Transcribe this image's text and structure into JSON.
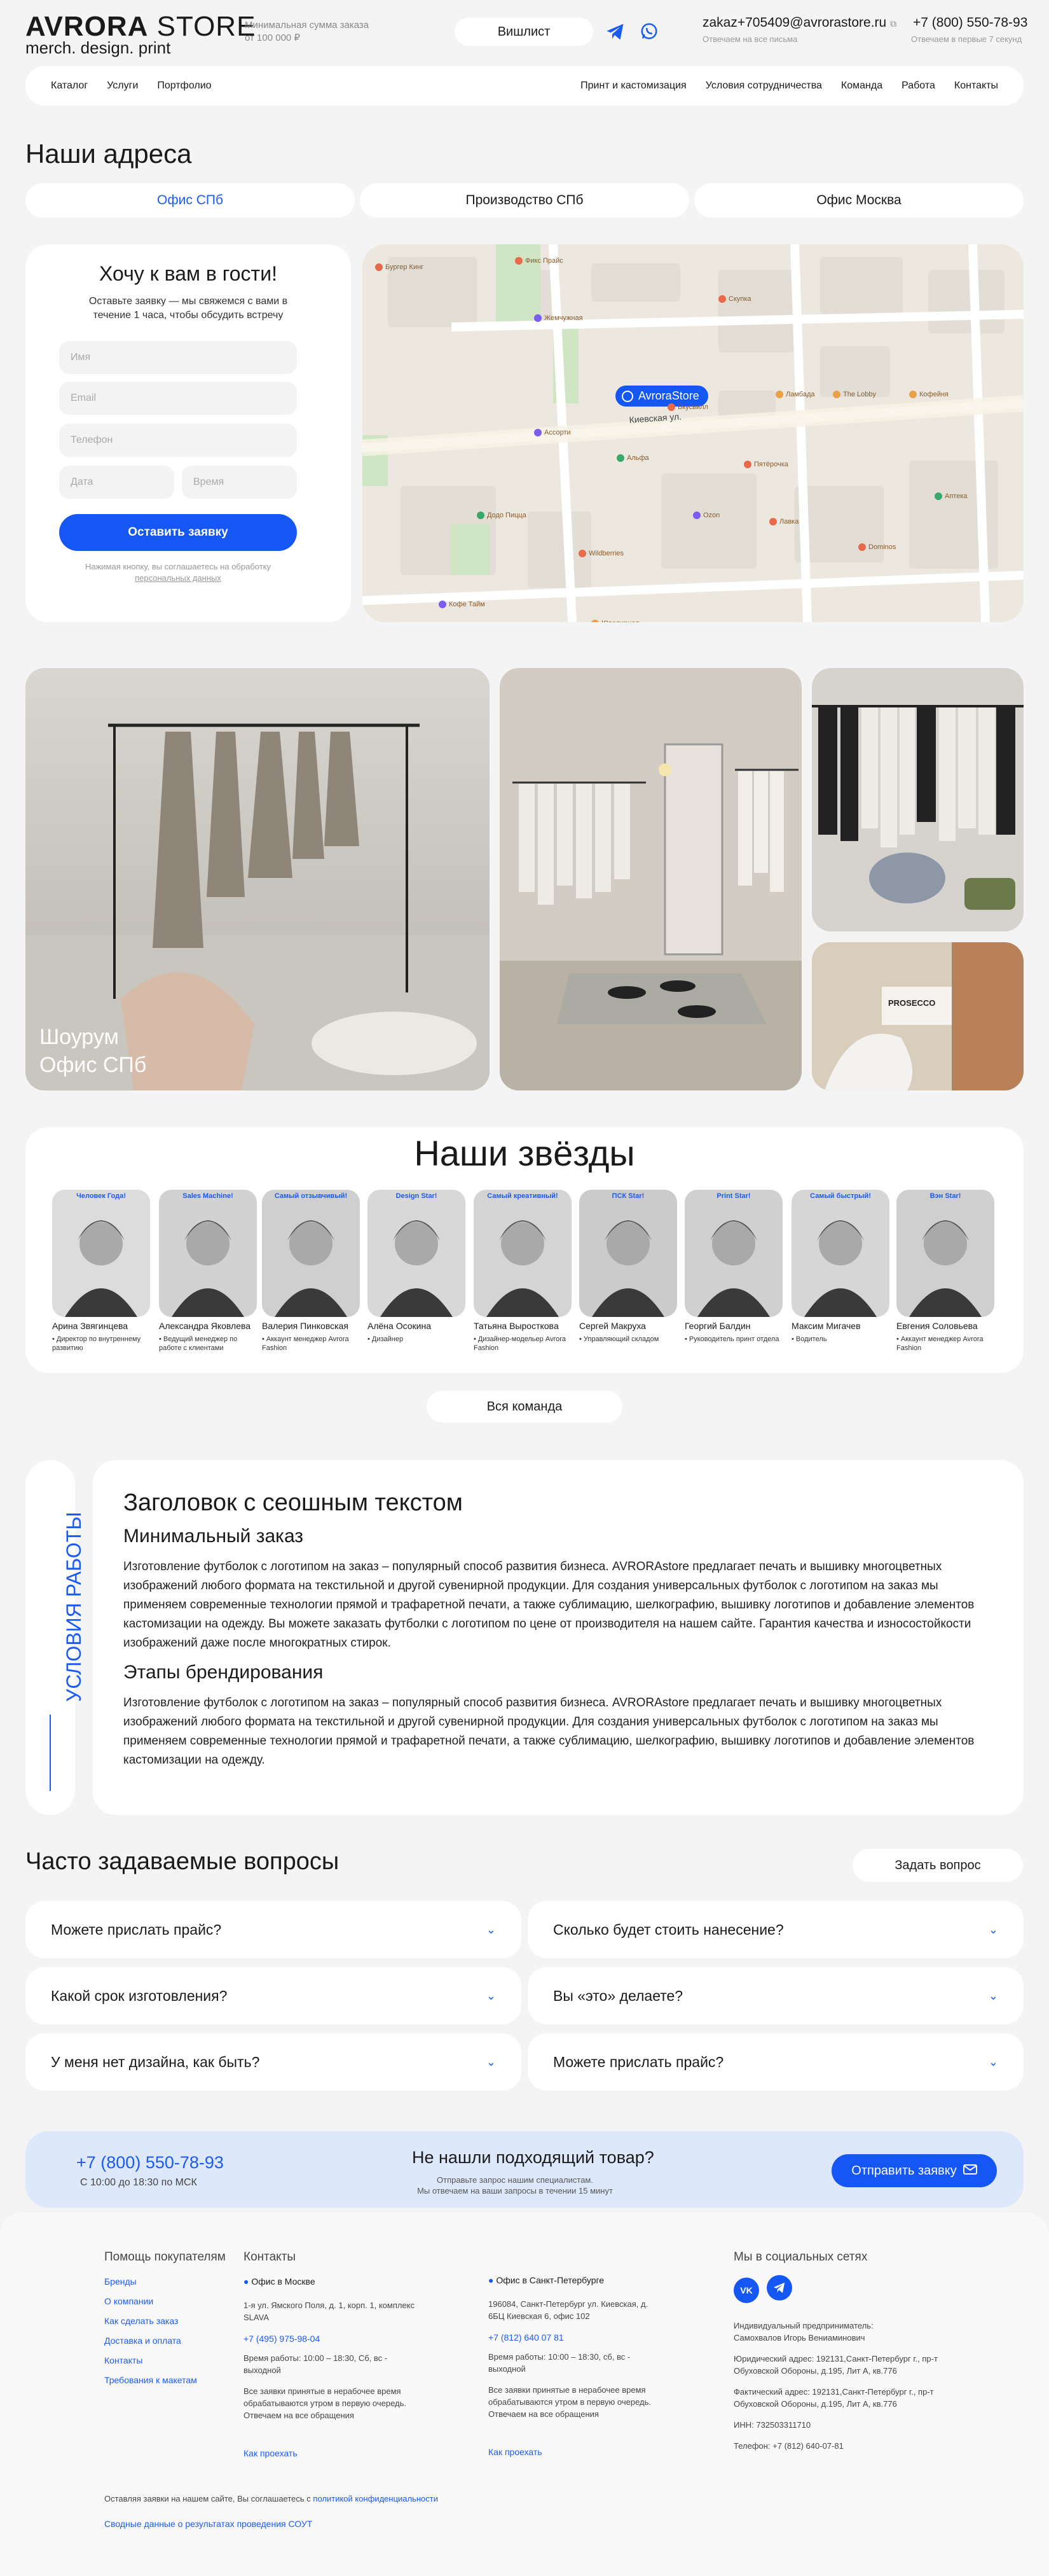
{
  "header": {
    "logo_main": "AVRORA",
    "logo_store": "STORE",
    "logo_tagline": "merch. design. print",
    "min_order_line1": "Минимальная сумма заказа",
    "min_order_line2": "от 100 000 ₽",
    "wishlist": "Вишлист",
    "email": "zakaz+705409@avrorastore.ru",
    "email_note": "Отвечаем на все письма",
    "phone": "+7 (800) 550-78-93",
    "phone_note": "Отвечаем в первые 7 секунд"
  },
  "nav": {
    "left": [
      "Каталог",
      "Услуги",
      "Портфолио"
    ],
    "right": [
      "Принт и кастомизация",
      "Условия сотрудничества",
      "Команда",
      "Работа",
      "Контакты"
    ]
  },
  "addresses": {
    "title": "Наши адреса",
    "tabs": [
      "Офис СПб",
      "Производство СПб",
      "Офис Москва"
    ],
    "active_tab": 0
  },
  "form": {
    "title": "Хочу к вам в гости!",
    "subtitle": "Оставьте заявку — мы свяжемся с вами в течение 1 часа, чтобы обсудить встречу",
    "name_ph": "Имя",
    "email_ph": "Email",
    "phone_ph": "Телефон",
    "date_ph": "Дата",
    "time_ph": "Время",
    "submit": "Оставить заявку",
    "consent_a": "Нажимая кнопку, вы соглашаетесь на обработку",
    "consent_b": "персональных данных"
  },
  "map": {
    "pin": "AvroraStore",
    "street": "Киевская ул.",
    "labels": [
      "Бургер Кинг",
      "Фикс Прайс",
      "Скупка",
      "Жемчужная",
      "Ламбада",
      "The Lobby",
      "Кофейня",
      "Пятёрочка",
      "Ассорти",
      "Альфа",
      "Вкусвилл",
      "Додо Пицца",
      "Wildberries",
      "Ozon",
      "Лавка",
      "Ювелирная",
      "Кофе Тайм",
      "Dominos",
      "Аптека"
    ]
  },
  "gallery": {
    "caption_line1": "Шоурум",
    "caption_line2": "Офис СПб",
    "sign": "PROSECCO"
  },
  "team": {
    "title": "Наши звёзды",
    "members": [
      {
        "badge": "Человек Года!",
        "name": "Арина Звягинцева",
        "role": "• Директор по внутреннему развитию"
      },
      {
        "badge": "Sales Machine!",
        "name": "Александра Яковлева",
        "role": "• Ведущий менеджер по работе с клиентами"
      },
      {
        "badge": "Самый отзывчивый!",
        "name": "Валерия Пинковская",
        "role": "• Аккаунт менеджер Avrora Fashion"
      },
      {
        "badge": "Design Star!",
        "name": "Алёна Осокина",
        "role": "• Дизайнер"
      },
      {
        "badge": "Самый креативный!",
        "name": "Татьяна Выростковa",
        "role": "• Дизайнер-модельер Avrora Fashion"
      },
      {
        "badge": "ПСК Star!",
        "name": "Сергей Макруха",
        "role": "• Управляющий складом"
      },
      {
        "badge": "Print Star!",
        "name": "Георгий Балдин",
        "role": "• Руководитель принт отдела"
      },
      {
        "badge": "Самый быстрый!",
        "name": "Максим Мигачев",
        "role": "• Водитель"
      },
      {
        "badge": "Вэн Star!",
        "name": "Евгения Соловьева",
        "role": "• Аккаунт менеджер Avrora Fashion"
      }
    ],
    "all_team": "Вся команда"
  },
  "conditions": {
    "side_label": "УСЛОВИЯ РАБОТЫ",
    "title": "Заголовок с сеошным текстом",
    "h_min": "Минимальный заказ",
    "p1": "Изготовление футболок с логотипом на заказ – популярный способ развития бизнеса. AVRORAstore предлагает печать и вышивку многоцветных изображений любого формата на текстильной и другой сувенирной продукции. Для создания универсальных футболок с логотипом на заказ мы применяем современные технологии прямой и трафаретной печати, а также сублимацию, шелкографию, вышивку логотипов и добавление элементов кастомизации на одежду. Вы можете заказать футболки с логотипом по цене от производителя на нашем сайте. Гарантия качества и износостойкости изображений даже после многократных стирок.",
    "h_stages": "Этапы брендирования",
    "p2": "Изготовление футболок с логотипом на заказ – популярный способ развития бизнеса. AVRORAstore предлагает печать и вышивку многоцветных изображений любого формата на текстильной и другой сувенирной продукции. Для создания универсальных футболок с логотипом на заказ мы применяем современные технологии прямой и трафаретной печати, а также сублимацию, шелкографию, вышивку логотипов и добавление элементов кастомизации на одежду."
  },
  "faq": {
    "title": "Часто задаваемые вопросы",
    "ask": "Задать вопрос",
    "items": [
      "Можете прислать прайс?",
      "Сколько будет стоить нанесение?",
      "Какой срок изготовления?",
      "Вы «это» делаете?",
      "У меня нет дизайна, как быть?",
      "Можете прислать прайс?"
    ]
  },
  "cta": {
    "phone": "+7 (800) 550-78-93",
    "hours": "С 10:00 до 18:30 по МСК",
    "title": "Не нашли подходящий товар?",
    "sub1": "Отправьте запрос нашим специалистам.",
    "sub2": "Мы отвечаем на ваши запросы в течении 15 минут",
    "button": "Отправить заявку"
  },
  "footer": {
    "help_title": "Помощь покупателям",
    "help_links": [
      "Бренды",
      "О компании",
      "Как сделать заказ",
      "Доставка и оплата",
      "Контакты",
      "Требования к макетам"
    ],
    "contacts_title": "Контакты",
    "msk_title": "Офис в Москве",
    "msk_addr": "1-я ул. Ямского Поля, д. 1, корп. 1, комплекс SLAVA",
    "msk_phone": "+7 (495) 975-98-04",
    "msk_hours": "Время работы: 10:00 – 18:30, Сб, вс - выходной",
    "msk_note": "Все заявки принятые в нерабочее время обрабатываются утром в первую очередь. Отвечаем на все обращения",
    "msk_route": "Как проехать",
    "spb_title": "Офис в Санкт-Петербурге",
    "spb_addr": "196084, Санкт-Петербург ул. Киевская, д. 6БЦ Киевская 6, офис 102",
    "spb_phone": "+7 (812) 640 07 81",
    "spb_hours": "Время работы: 10:00 – 18:30, сб, вс - выходной",
    "spb_note": "Все заявки принятые в нерабочее время обрабатываются утром в первую очередь. Отвечаем на все обращения",
    "spb_route": "Как проехать",
    "social_title": "Мы в социальных сетях",
    "vk": "VK",
    "ip_line1": "Индивидуальный предприниматель:",
    "ip_line2": "Самохвалов Игорь Вениаминович",
    "legal_addr": "Юридический адрес: 192131,Санкт-Петербург г., пр-т Обуховской Обороны, д.195, Лит А, кв.776",
    "fact_addr": "Фактический адрес: 192131,Санкт-Петербург г., пр-т Обуховской Обороны, д.195, Лит А, кв.776",
    "inn": "ИНН: 732503311710",
    "phone": "Телефон: +7 (812) 640-07-81",
    "privacy_prefix": "Оставляя заявки на нашем сайте, Вы соглашаетесь с",
    "privacy_link": "политикой конфиденциальности",
    "sout": "Сводные данные о результатах проведения СОУТ"
  },
  "colors": {
    "accent": "#1457f5",
    "background": "#f4f4f5",
    "card": "#ffffff",
    "cta_bg": "#dde8fb"
  }
}
